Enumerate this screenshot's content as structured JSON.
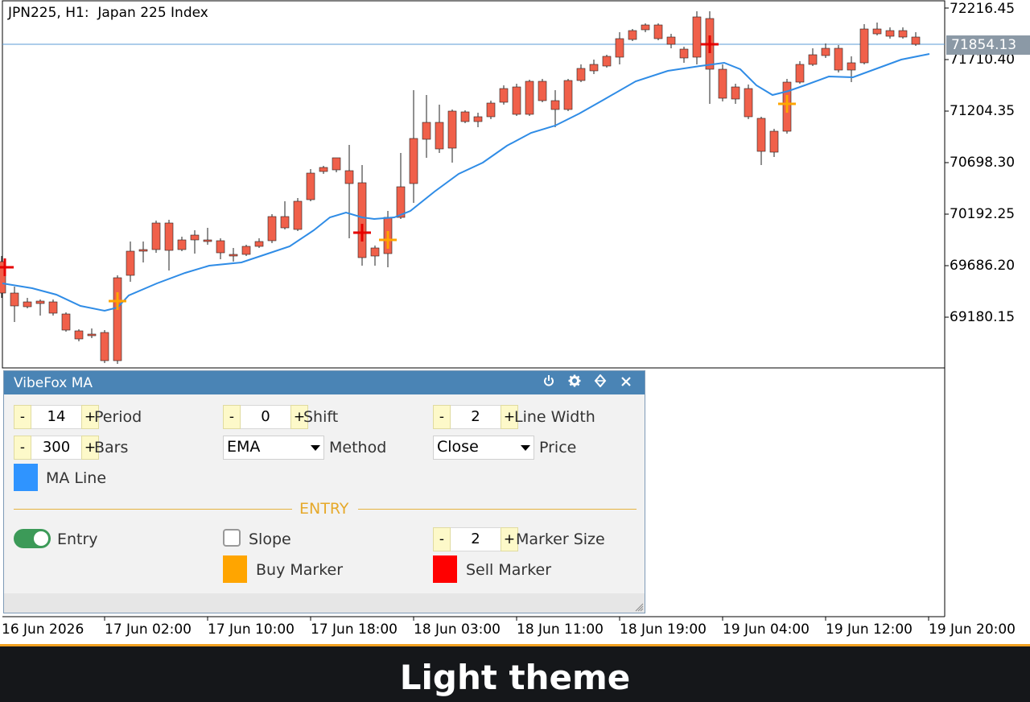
{
  "chart": {
    "title": "JPN225, H1:  Japan 225 Index",
    "current_price": "71854.13",
    "price_axis": [
      "72216.45",
      "71710.40",
      "71204.35",
      "70698.30",
      "70192.25",
      "69686.20",
      "69180.15"
    ],
    "time_axis": [
      "16 Jun 2026",
      "17 Jun 02:00",
      "17 Jun 10:00",
      "17 Jun 18:00",
      "18 Jun 03:00",
      "18 Jun 11:00",
      "18 Jun 19:00",
      "19 Jun 04:00",
      "19 Jun 12:00",
      "19 Jun 20:00"
    ],
    "colors": {
      "bull": "#3cc24a",
      "bear": "#f0604a",
      "ma_line": "#2f8ce6",
      "buy_marker": "#ffa500",
      "sell_marker": "#e60000",
      "current_price_line": "#5b9bd5"
    }
  },
  "panel": {
    "title": "VibeFox MA",
    "icons": [
      "power-icon",
      "gear-icon",
      "move-icon",
      "close-icon"
    ],
    "period": {
      "label": "Period",
      "value": "14"
    },
    "shift": {
      "label": "Shift",
      "value": "0"
    },
    "line_width": {
      "label": "Line Width",
      "value": "2"
    },
    "bars": {
      "label": "Bars",
      "value": "300"
    },
    "method": {
      "label": "Method",
      "value": "EMA"
    },
    "price": {
      "label": "Price",
      "value": "Close"
    },
    "ma_line": {
      "label": "MA Line",
      "color": "#2f94ff"
    },
    "section_title": "ENTRY",
    "entry": {
      "label": "Entry",
      "enabled": true
    },
    "slope": {
      "label": "Slope",
      "checked": false
    },
    "marker_size": {
      "label": "Marker Size",
      "value": "2"
    },
    "buy_marker": {
      "label": "Buy Marker",
      "color": "#ffa500"
    },
    "sell_marker": {
      "label": "Sell Marker",
      "color": "#ff0000"
    },
    "minus": "-",
    "plus": "+"
  },
  "footer": {
    "theme_label": "Light theme"
  }
}
